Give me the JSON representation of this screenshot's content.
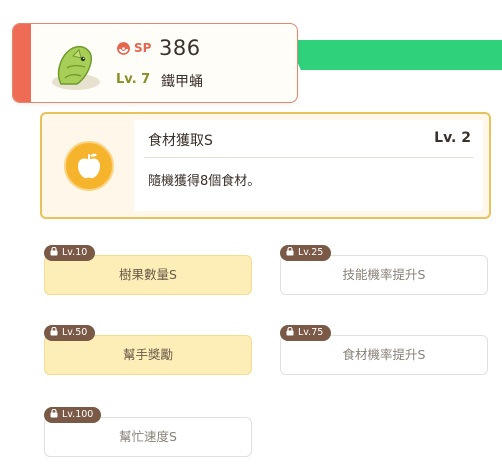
{
  "pokemon": {
    "sp_label": "SP",
    "sp_value": "386",
    "level_label": "Lv. 7",
    "name": "鐵甲蛹",
    "icons": {
      "sp": "pokeball-icon",
      "avatar": "metapod-avatar"
    }
  },
  "main_skill": {
    "name": "食材獲取S",
    "level": "Lv. 2",
    "description": "隨機獲得8個食材。",
    "icon": "apple-icon"
  },
  "sub_skills": [
    {
      "unlock_level": "Lv.10",
      "name": "樹果數量S",
      "unlocked": true
    },
    {
      "unlock_level": "Lv.25",
      "name": "技能機率提升S",
      "unlocked": false
    },
    {
      "unlock_level": "Lv.50",
      "name": "幫手獎勵",
      "unlocked": true
    },
    {
      "unlock_level": "Lv.75",
      "name": "食材機率提升S",
      "unlocked": false
    },
    {
      "unlock_level": "Lv.100",
      "name": "幫忙速度S",
      "unlocked": false
    }
  ],
  "colors": {
    "accent_green": "#2fd17a",
    "accent_red": "#ee6b55",
    "gold_border": "#e8c25a",
    "tag_brown": "#7a5a47"
  }
}
